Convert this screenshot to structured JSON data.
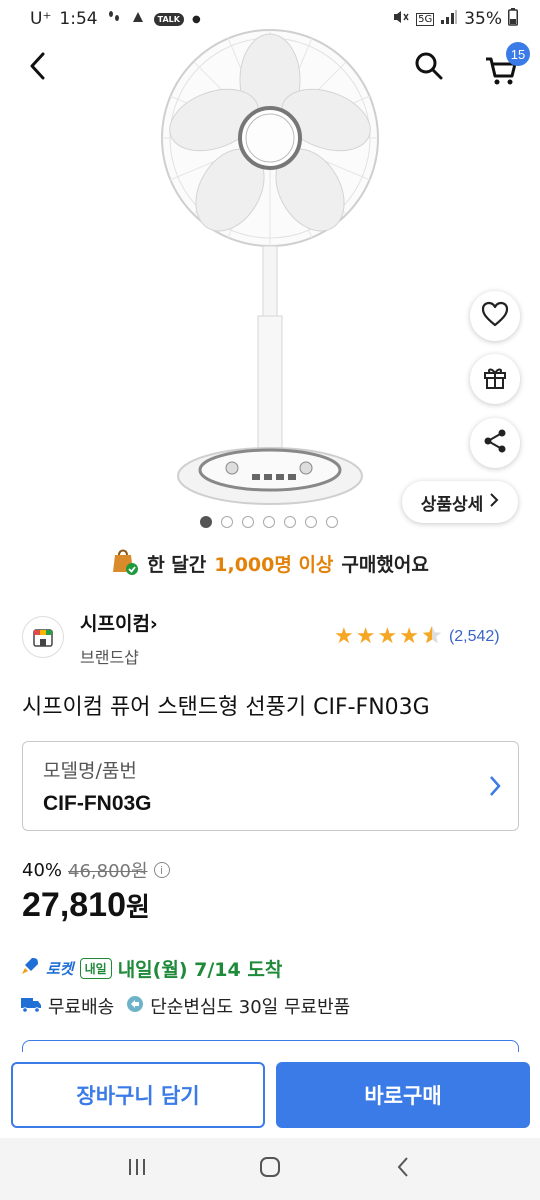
{
  "status_bar": {
    "carrier": "U⁺",
    "time": "1:54",
    "network": "5G",
    "battery": "35%"
  },
  "header": {
    "cart_count": "15"
  },
  "floating": {
    "detail_label": "상품상세"
  },
  "pager": {
    "total": 7,
    "active": 0
  },
  "banner": {
    "prefix": "한 달간",
    "highlight": "1,000명 이상",
    "suffix": "구매했어요"
  },
  "seller": {
    "name": "시프이컴",
    "sub": "브랜드샵",
    "rating_count": "(2,542)",
    "rating": 4.5
  },
  "product": {
    "title": "시프이컴 퓨어 스탠드형 선풍기 CIF-FN03G"
  },
  "option": {
    "label": "모델명/품번",
    "value": "CIF-FN03G"
  },
  "price": {
    "discount_rate": "40%",
    "original": "46,800원",
    "sale": "27,810",
    "currency": "원"
  },
  "delivery": {
    "rocket": "로켓",
    "tomorrow_badge": "내일",
    "arrival": "내일(월) 7/14 도착",
    "free_shipping": "무료배송",
    "return_policy": "단순변심도 30일 무료반품"
  },
  "cta": {
    "cart": "장바구니 담기",
    "buy": "바로구매"
  },
  "colors": {
    "accent": "#3b7be8",
    "highlight": "#e2820a",
    "delivery_green": "#1e8a3a",
    "star": "#f5a623"
  }
}
